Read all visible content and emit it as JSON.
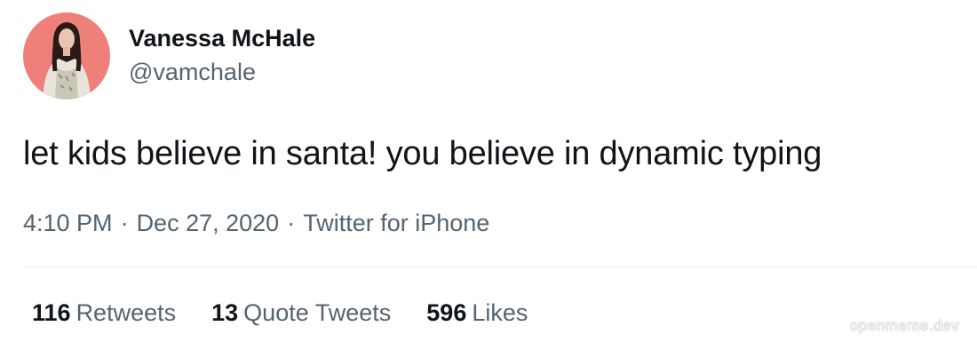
{
  "author": {
    "display_name": "Vanessa McHale",
    "handle": "@vamchale",
    "avatar_bg": "#f0807a"
  },
  "tweet": {
    "text": "let kids believe in santa! you believe in dynamic typing",
    "time": "4:10 PM",
    "date": "Dec 27, 2020",
    "source": "Twitter for iPhone",
    "separator": "·"
  },
  "stats": {
    "retweets_count": "116",
    "retweets_label": "Retweets",
    "quotes_count": "13",
    "quotes_label": "Quote Tweets",
    "likes_count": "596",
    "likes_label": "Likes"
  },
  "watermark": "openmeme.dev",
  "colors": {
    "primary_text": "#0f1419",
    "secondary_text": "#536471",
    "divider": "#e6ecf0"
  }
}
